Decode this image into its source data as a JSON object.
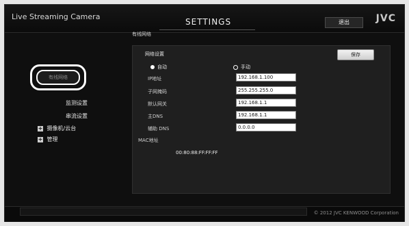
{
  "header": {
    "app_title": "Live Streaming Camera",
    "page_title": "SETTINGS",
    "exit_button": "退出",
    "brand": "JVC"
  },
  "sidebar": {
    "selected_item": "有线网络",
    "items": [
      {
        "label": "监测设置"
      },
      {
        "label": "串流设置"
      },
      {
        "label": "摄像机/云台"
      },
      {
        "label": "管理"
      }
    ]
  },
  "section": {
    "label": "有线网络"
  },
  "panel": {
    "title": "网络设置",
    "save_button": "保存",
    "mode_options": [
      {
        "label": "自动"
      },
      {
        "label": "手动"
      }
    ],
    "fields": [
      {
        "label": "IP地址",
        "value": "192.168.1.100"
      },
      {
        "label": "子网掩码",
        "value": "255.255.255.0"
      },
      {
        "label": "默认网关",
        "value": "192.168.1.1"
      },
      {
        "label": "主DNS",
        "value": "192.168.1.1"
      },
      {
        "label": "辅助 DNS",
        "value": "0.0.0.0"
      }
    ],
    "mac_label": "MAC地址",
    "mac_value": "00:80:88:FF:FF:FF"
  },
  "footer": {
    "copyright": "© 2012 JVC KENWOOD Corporation"
  }
}
